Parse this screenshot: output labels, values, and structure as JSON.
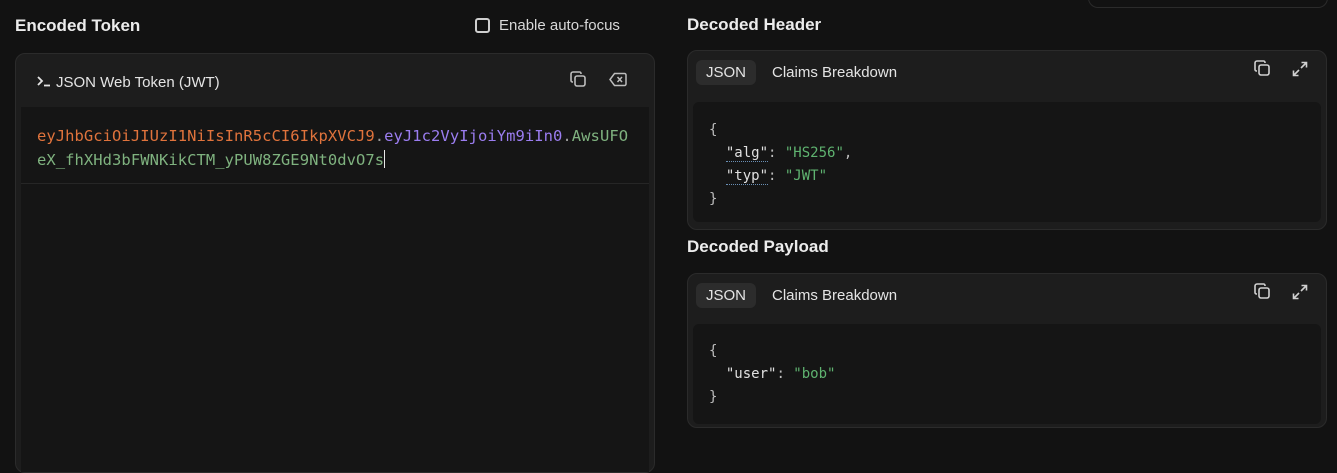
{
  "encoded": {
    "title": "Encoded Token",
    "autofocus_label": "Enable auto-focus",
    "panel_label": "JSON Web Token (JWT)",
    "token_header": "eyJhbGciOiJIUzI1NiIsInR5cCI6IkpXVCJ9",
    "dot1": ".",
    "token_payload": "eyJ1c2VyIjoiYm9iIn0",
    "dot2": ".",
    "token_signature": "AwsUFOeX_fhXHd3bFWNKikCTM_yPUW8ZGE9Nt0dvO7s",
    "icons": {
      "copy": "copy-icon",
      "clear": "clear-icon",
      "prompt": "terminal-prompt-icon"
    }
  },
  "header": {
    "title": "Decoded Header",
    "tabs": [
      "JSON",
      "Claims Breakdown"
    ],
    "open_brace": "{",
    "close_brace": "}",
    "fields": [
      {
        "key": "\"alg\"",
        "sep": ": ",
        "value": "\"HS256\"",
        "comma": ","
      },
      {
        "key": "\"typ\"",
        "sep": ": ",
        "value": "\"JWT\"",
        "comma": ""
      }
    ]
  },
  "payload": {
    "title": "Decoded Payload",
    "tabs": [
      "JSON",
      "Claims Breakdown"
    ],
    "open_brace": "{",
    "close_brace": "}",
    "fields": [
      {
        "key": "\"user\"",
        "sep": ": ",
        "value": "\"bob\"",
        "comma": ""
      }
    ]
  },
  "colors": {
    "header_segment": "#e0733c",
    "payload_segment": "#9b7df0",
    "signature_segment": "#7fb27f",
    "json_string": "#5fb370"
  }
}
